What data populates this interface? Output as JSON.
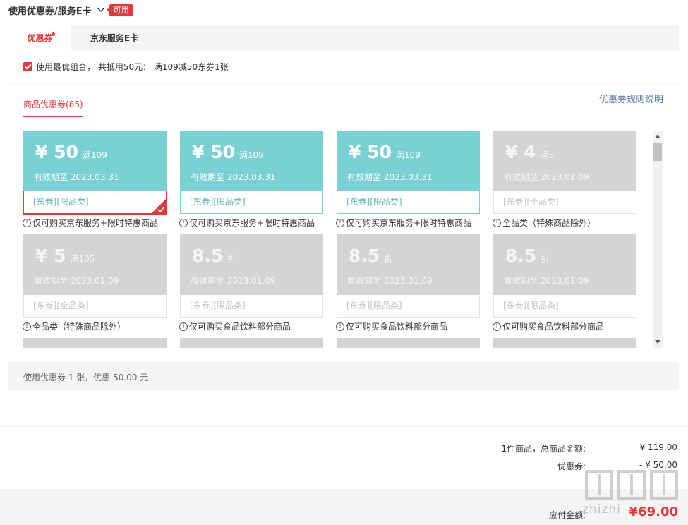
{
  "header": {
    "title": "使用优惠券/服务E卡",
    "badge": "可用"
  },
  "tabs": [
    {
      "label": "优惠券"
    },
    {
      "label": "京东服务E卡"
    }
  ],
  "combo": {
    "text": "使用最优组合， 共抵用50元： 满109减50东券1张"
  },
  "coupon_section": {
    "subtab": "商品优惠券(85)",
    "rules_link": "优惠券规则说明",
    "coupons": [
      {
        "amount": "¥ 50",
        "condition": "满109",
        "expiry": "有效期至 2023.03.31",
        "tags": "[东券][限品类]",
        "description": "仅可购买京东服务+限时特惠商品",
        "state": "selected"
      },
      {
        "amount": "¥ 50",
        "condition": "满109",
        "expiry": "有效期至 2023.03.31",
        "tags": "[东券][限品类]",
        "description": "仅可购买京东服务+限时特惠商品",
        "state": "active"
      },
      {
        "amount": "¥ 50",
        "condition": "满109",
        "expiry": "有效期至 2023.03.31",
        "tags": "[东券][限品类]",
        "description": "仅可购买京东服务+限时特惠商品",
        "state": "active"
      },
      {
        "amount": "¥ 4",
        "condition": "满5",
        "expiry": "有效期至 2023.01.09",
        "tags": "[东券][全品类]",
        "description": "全品类（特殊商品除外）",
        "state": "gray"
      },
      {
        "amount": "¥ 5",
        "condition": "满105",
        "expiry": "有效期至 2023.01.09",
        "tags": "[东券][全品类]",
        "description": "全品类（特殊商品除外）",
        "state": "gray"
      },
      {
        "amount": "8.5",
        "condition": "折",
        "expiry": "有效期至 2023.01.09",
        "tags": "[东券][限品类]",
        "description": "仅可购买食品饮料部分商品",
        "state": "gray"
      },
      {
        "amount": "8.5",
        "condition": "折",
        "expiry": "有效期至 2023.01.09",
        "tags": "[东券][限品类]",
        "description": "仅可购买食品饮料部分商品",
        "state": "gray"
      },
      {
        "amount": "8.5",
        "condition": "折",
        "expiry": "有效期至 2023.01.09",
        "tags": "[东券][限品类]",
        "description": "仅可购买食品饮料部分商品",
        "state": "gray"
      }
    ],
    "usage_summary": "使用优惠券 1 张，优惠 50.00 元"
  },
  "totals": {
    "items_label": "1件商品，总商品金额:",
    "items_value": "¥ 119.00",
    "coupon_label": "优惠券:",
    "coupon_value": "- ¥ 50.00",
    "payable_label": "应付金额:",
    "payable_value": "¥69.00"
  },
  "watermark": {
    "text": "zhizhi"
  },
  "colors": {
    "accent": "#e4393c",
    "coupon_active": "#79d1d4",
    "coupon_gray": "#d4d4d4",
    "link": "#5e7fa8"
  }
}
